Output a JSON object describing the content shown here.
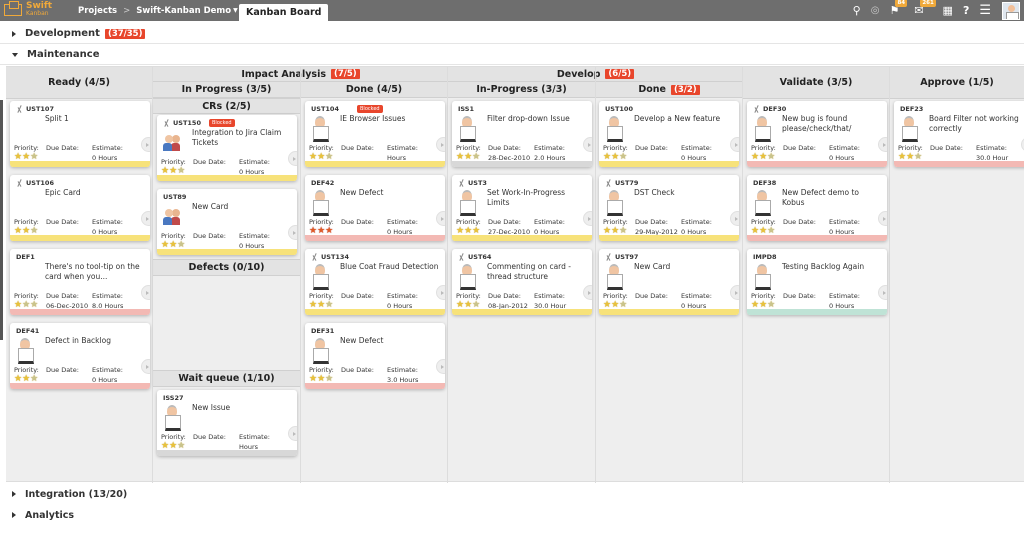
{
  "app": {
    "logo_line1": "Swift",
    "logo_line2": "Kanban"
  },
  "breadcrumb": {
    "projects": "Projects",
    "project": "Swift-Kanban Demo",
    "current": "Kanban Board",
    "separator": ">"
  },
  "toolbar": {
    "notifications_count": "84",
    "messages_count": "261",
    "help_label": "?"
  },
  "swimlanes": {
    "development": {
      "label": "Development",
      "count": "(37/35)"
    },
    "maintenance": {
      "label": "Maintenance"
    },
    "integration": {
      "label": "Integration (13/20)"
    },
    "analytics": {
      "label": "Analytics"
    }
  },
  "columns": {
    "ready": "Ready (4/5)",
    "impact": {
      "label": "Impact Analysis",
      "count": "(7/5)",
      "in_progress": "In Progress (3/5)",
      "crs": "CRs (2/5)",
      "defects": "Defects (0/10)",
      "wait_queue": "Wait queue (1/10)",
      "done": "Done (4/5)"
    },
    "develop": {
      "label": "Develop",
      "count": "(6/5)",
      "in_progress": "In-Progress (3/3)",
      "done_label": "Done",
      "done_count": "(3/2)"
    },
    "validate": "Validate (3/5)",
    "approve": "Approve (1/5)"
  },
  "card_labels": {
    "priority": "Priority:",
    "due": "Due Date:",
    "estimate": "Estimate:",
    "blocked": "Blocked"
  },
  "cards": [
    {
      "id": "UST107",
      "title": "Split 1",
      "due": "",
      "estimate": "0 Hours",
      "stars": 2,
      "bar": "yellow",
      "split": true,
      "pic": "none"
    },
    {
      "id": "UST106",
      "title": "Epic Card",
      "due": "",
      "estimate": "0 Hours",
      "stars": 2,
      "bar": "yellow",
      "split": true,
      "pic": "none"
    },
    {
      "id": "DEF1",
      "title": "There's no tool-tip on the card when you...",
      "due": "06-Dec-2010",
      "estimate": "8.0 Hours",
      "stars": 1,
      "bar": "pink",
      "split": false,
      "pic": "none"
    },
    {
      "id": "DEF41",
      "title": "Defect in Backlog",
      "due": "",
      "estimate": "0 Hours",
      "stars": 2,
      "bar": "pink",
      "split": false,
      "pic": "man"
    },
    {
      "id": "UST150",
      "title": "Integration to Jira Claim Tickets",
      "due": "",
      "estimate": "0 Hours",
      "stars": 2,
      "bar": "yellow",
      "split": true,
      "blocked": true,
      "pic": "group"
    },
    {
      "id": "UST89",
      "title": "New Card",
      "due": "",
      "estimate": "0 Hours",
      "stars": 2,
      "bar": "yellow",
      "split": false,
      "pic": "group"
    },
    {
      "id": "ISS27",
      "title": "New Issue",
      "due": "",
      "estimate": "Hours",
      "stars": 2,
      "bar": "grey",
      "split": false,
      "pic": "man"
    },
    {
      "id": "UST104",
      "title": "IE Browser Issues",
      "due": "",
      "estimate": "Hours",
      "stars": 2,
      "bar": "yellow",
      "split": false,
      "blocked": true,
      "pic": "man"
    },
    {
      "id": "DEF42",
      "title": "New Defect",
      "due": "",
      "estimate": "0 Hours",
      "stars": 3,
      "starColor": "red",
      "bar": "pink",
      "split": false,
      "pic": "man"
    },
    {
      "id": "UST134",
      "title": "Blue Coat Fraud Detection",
      "due": "",
      "estimate": "0 Hours",
      "stars": 2,
      "bar": "yellow",
      "split": true,
      "pic": "man"
    },
    {
      "id": "DEF31",
      "title": "New Defect",
      "due": "",
      "estimate": "3.0 Hours",
      "stars": 2,
      "bar": "pink",
      "split": false,
      "pic": "man"
    },
    {
      "id": "ISS1",
      "title": "Filter drop-down Issue",
      "due": "28-Dec-2010",
      "estimate": "2.0 Hours",
      "stars": 2,
      "bar": "grey",
      "split": false,
      "pic": "man"
    },
    {
      "id": "UST3",
      "title": "Set Work-In-Progress Limits",
      "due": "27-Dec-2010",
      "estimate": "0 Hours",
      "stars": 3,
      "bar": "yellow",
      "split": true,
      "pic": "man"
    },
    {
      "id": "UST64",
      "title": "Commenting on card - thread structure",
      "due": "08-Jan-2012",
      "estimate": "30.0 Hour",
      "stars": 2,
      "bar": "yellow",
      "split": true,
      "pic": "man"
    },
    {
      "id": "UST100",
      "title": "Develop a New feature",
      "due": "",
      "estimate": "0 Hours",
      "stars": 2,
      "bar": "yellow",
      "split": false,
      "pic": "man"
    },
    {
      "id": "UST79",
      "title": "DST Check",
      "due": "29-May-2012",
      "estimate": "0 Hours",
      "stars": 2,
      "bar": "yellow",
      "split": true,
      "pic": "man"
    },
    {
      "id": "UST97",
      "title": "New Card",
      "due": "",
      "estimate": "0 Hours",
      "stars": 2,
      "bar": "yellow",
      "split": true,
      "pic": "man"
    },
    {
      "id": "DEF30",
      "title": "New bug is found please/check/that/",
      "due": "",
      "estimate": "0 Hours",
      "stars": 2,
      "bar": "pink",
      "split": true,
      "pic": "man"
    },
    {
      "id": "DEF38",
      "title": "New Defect demo to Kobus",
      "due": "",
      "estimate": "0 Hours",
      "stars": 2,
      "bar": "pink",
      "split": false,
      "pic": "man"
    },
    {
      "id": "IMPD8",
      "title": "Testing Backlog Again",
      "due": "",
      "estimate": "0 Hours",
      "stars": 2,
      "bar": "green",
      "split": false,
      "pic": "man"
    },
    {
      "id": "DEF23",
      "title": "Board Filter not working correctly",
      "due": "",
      "estimate": "30.0 Hour",
      "stars": 2,
      "bar": "pink",
      "split": false,
      "pic": "man"
    }
  ]
}
